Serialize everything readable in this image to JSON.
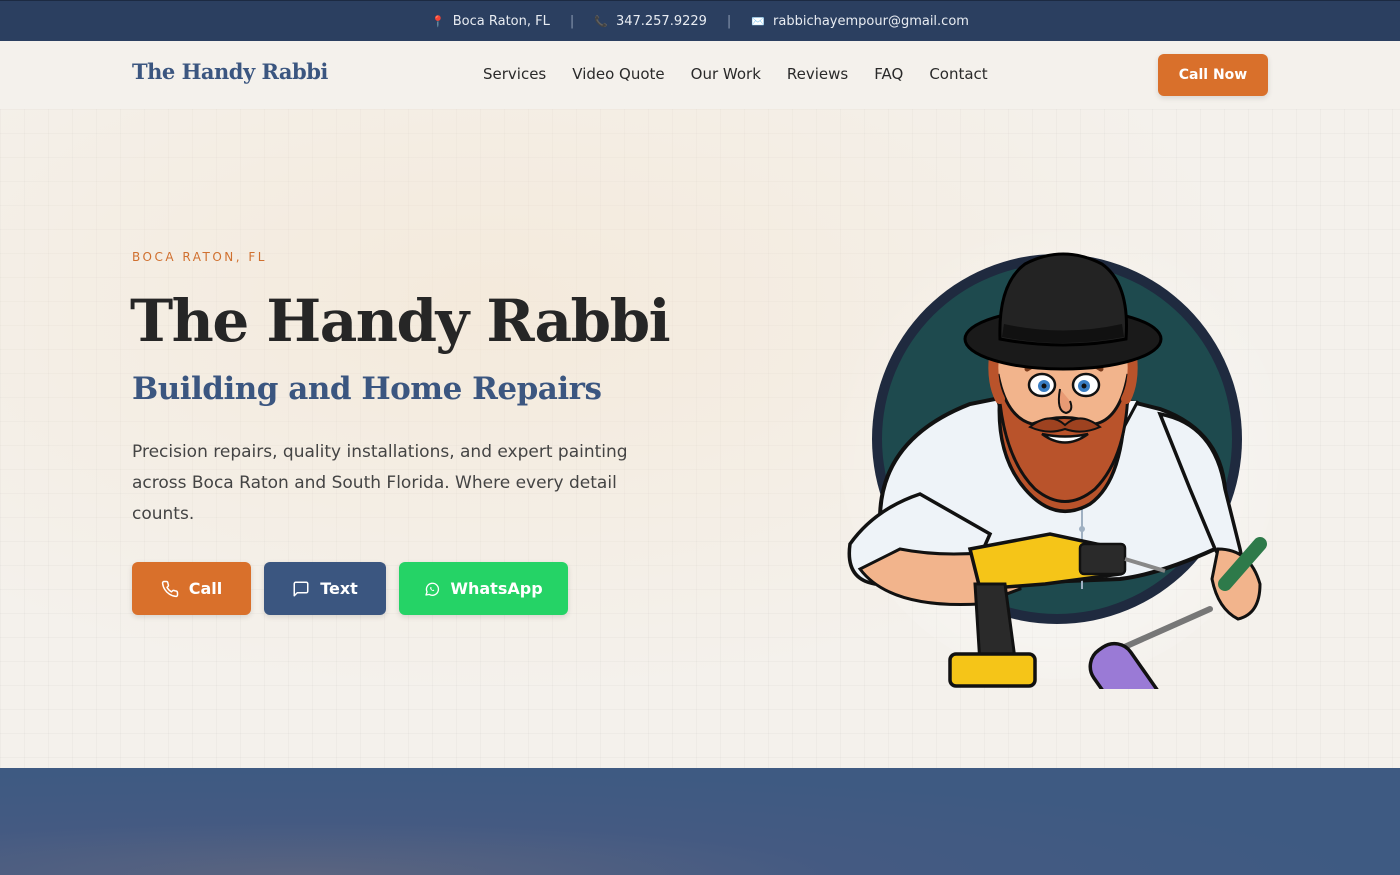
{
  "topbar": {
    "location": "Boca Raton, FL",
    "phone": "347.257.9229",
    "email": "rabbichayempour@gmail.com",
    "separator": "|",
    "icons": [
      "pin-icon",
      "phone-icon",
      "envelope-icon"
    ]
  },
  "nav": {
    "logo": "The Handy Rabbi",
    "items": [
      "Services",
      "Video Quote",
      "Our Work",
      "Reviews",
      "FAQ",
      "Contact"
    ],
    "cta": "Call Now"
  },
  "hero": {
    "eyebrow": "BOCA RATON, FL",
    "title": "The Handy Rabbi",
    "subtitle": "Building and Home Repairs",
    "description": "Precision repairs, quality installations, and expert painting across Boca Raton and South Florida. Where every detail counts.",
    "buttons": {
      "call": "Call",
      "text": "Text",
      "whatsapp": "WhatsApp"
    },
    "illustration": "handyman-rabbi-mascot"
  },
  "colors": {
    "navy": "#2b3f60",
    "brand_blue": "#3b5680",
    "accent_orange": "#d9702b",
    "whatsapp_green": "#25d366",
    "background": "#f4f1ec"
  }
}
